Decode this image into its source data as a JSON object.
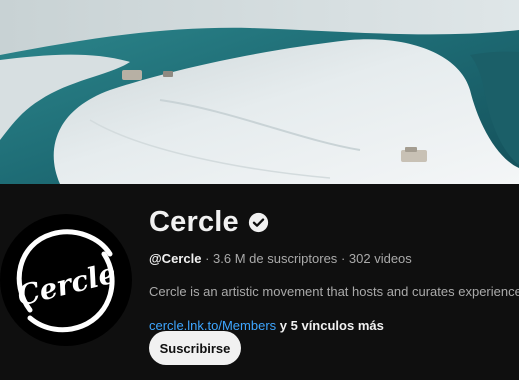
{
  "channel": {
    "name": "Cercle",
    "handle": "@Cercle",
    "subscribers": "3.6 M de suscriptores",
    "videos": "302 videos",
    "separator": "·",
    "description": "Cercle is an artistic movement that hosts and curates experiences,",
    "link_text": "cercle.lnk.to/Members",
    "more_links": "y 5 vínculos más",
    "subscribe_label": "Suscribirse",
    "avatar_text": "Cercle",
    "verified_icon": "verified-check-icon"
  },
  "colors": {
    "background": "#0f0f0f",
    "text_primary": "#f1f1f1",
    "text_secondary": "#aaaaaa",
    "link": "#3ea6ff",
    "button_bg": "#f1f1f1",
    "lagoon": "#1f6a73",
    "sand": "#e9eef0"
  }
}
